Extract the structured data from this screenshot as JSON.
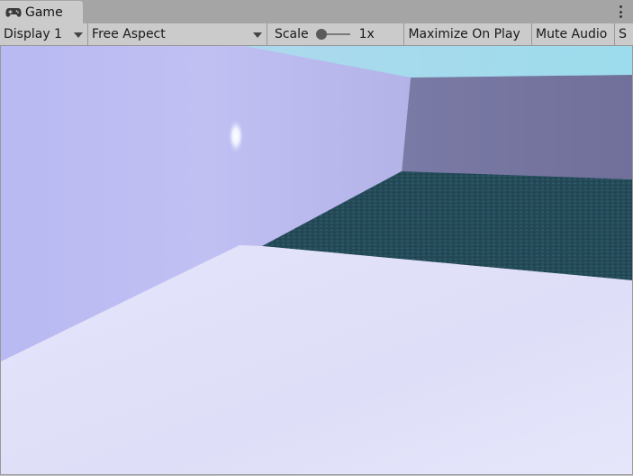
{
  "tab": {
    "label": "Game",
    "icon": "gamepad-icon"
  },
  "toolbar": {
    "display": "Display 1",
    "aspect": "Free Aspect",
    "scale_label": "Scale",
    "scale_value": "1x",
    "scale_level": 0.0,
    "maximize": "Maximize On Play",
    "mute": "Mute Audio",
    "overflow_text": "S"
  },
  "colors": {
    "toolbar_bg": "#cbcbcb",
    "tabstrip_bg": "#a5a5a5",
    "sky": "#a9dcec",
    "wall_left": "#bebef2",
    "wall_far": "#76769e",
    "water": "#244a58",
    "floor": "#e2e2fa"
  }
}
